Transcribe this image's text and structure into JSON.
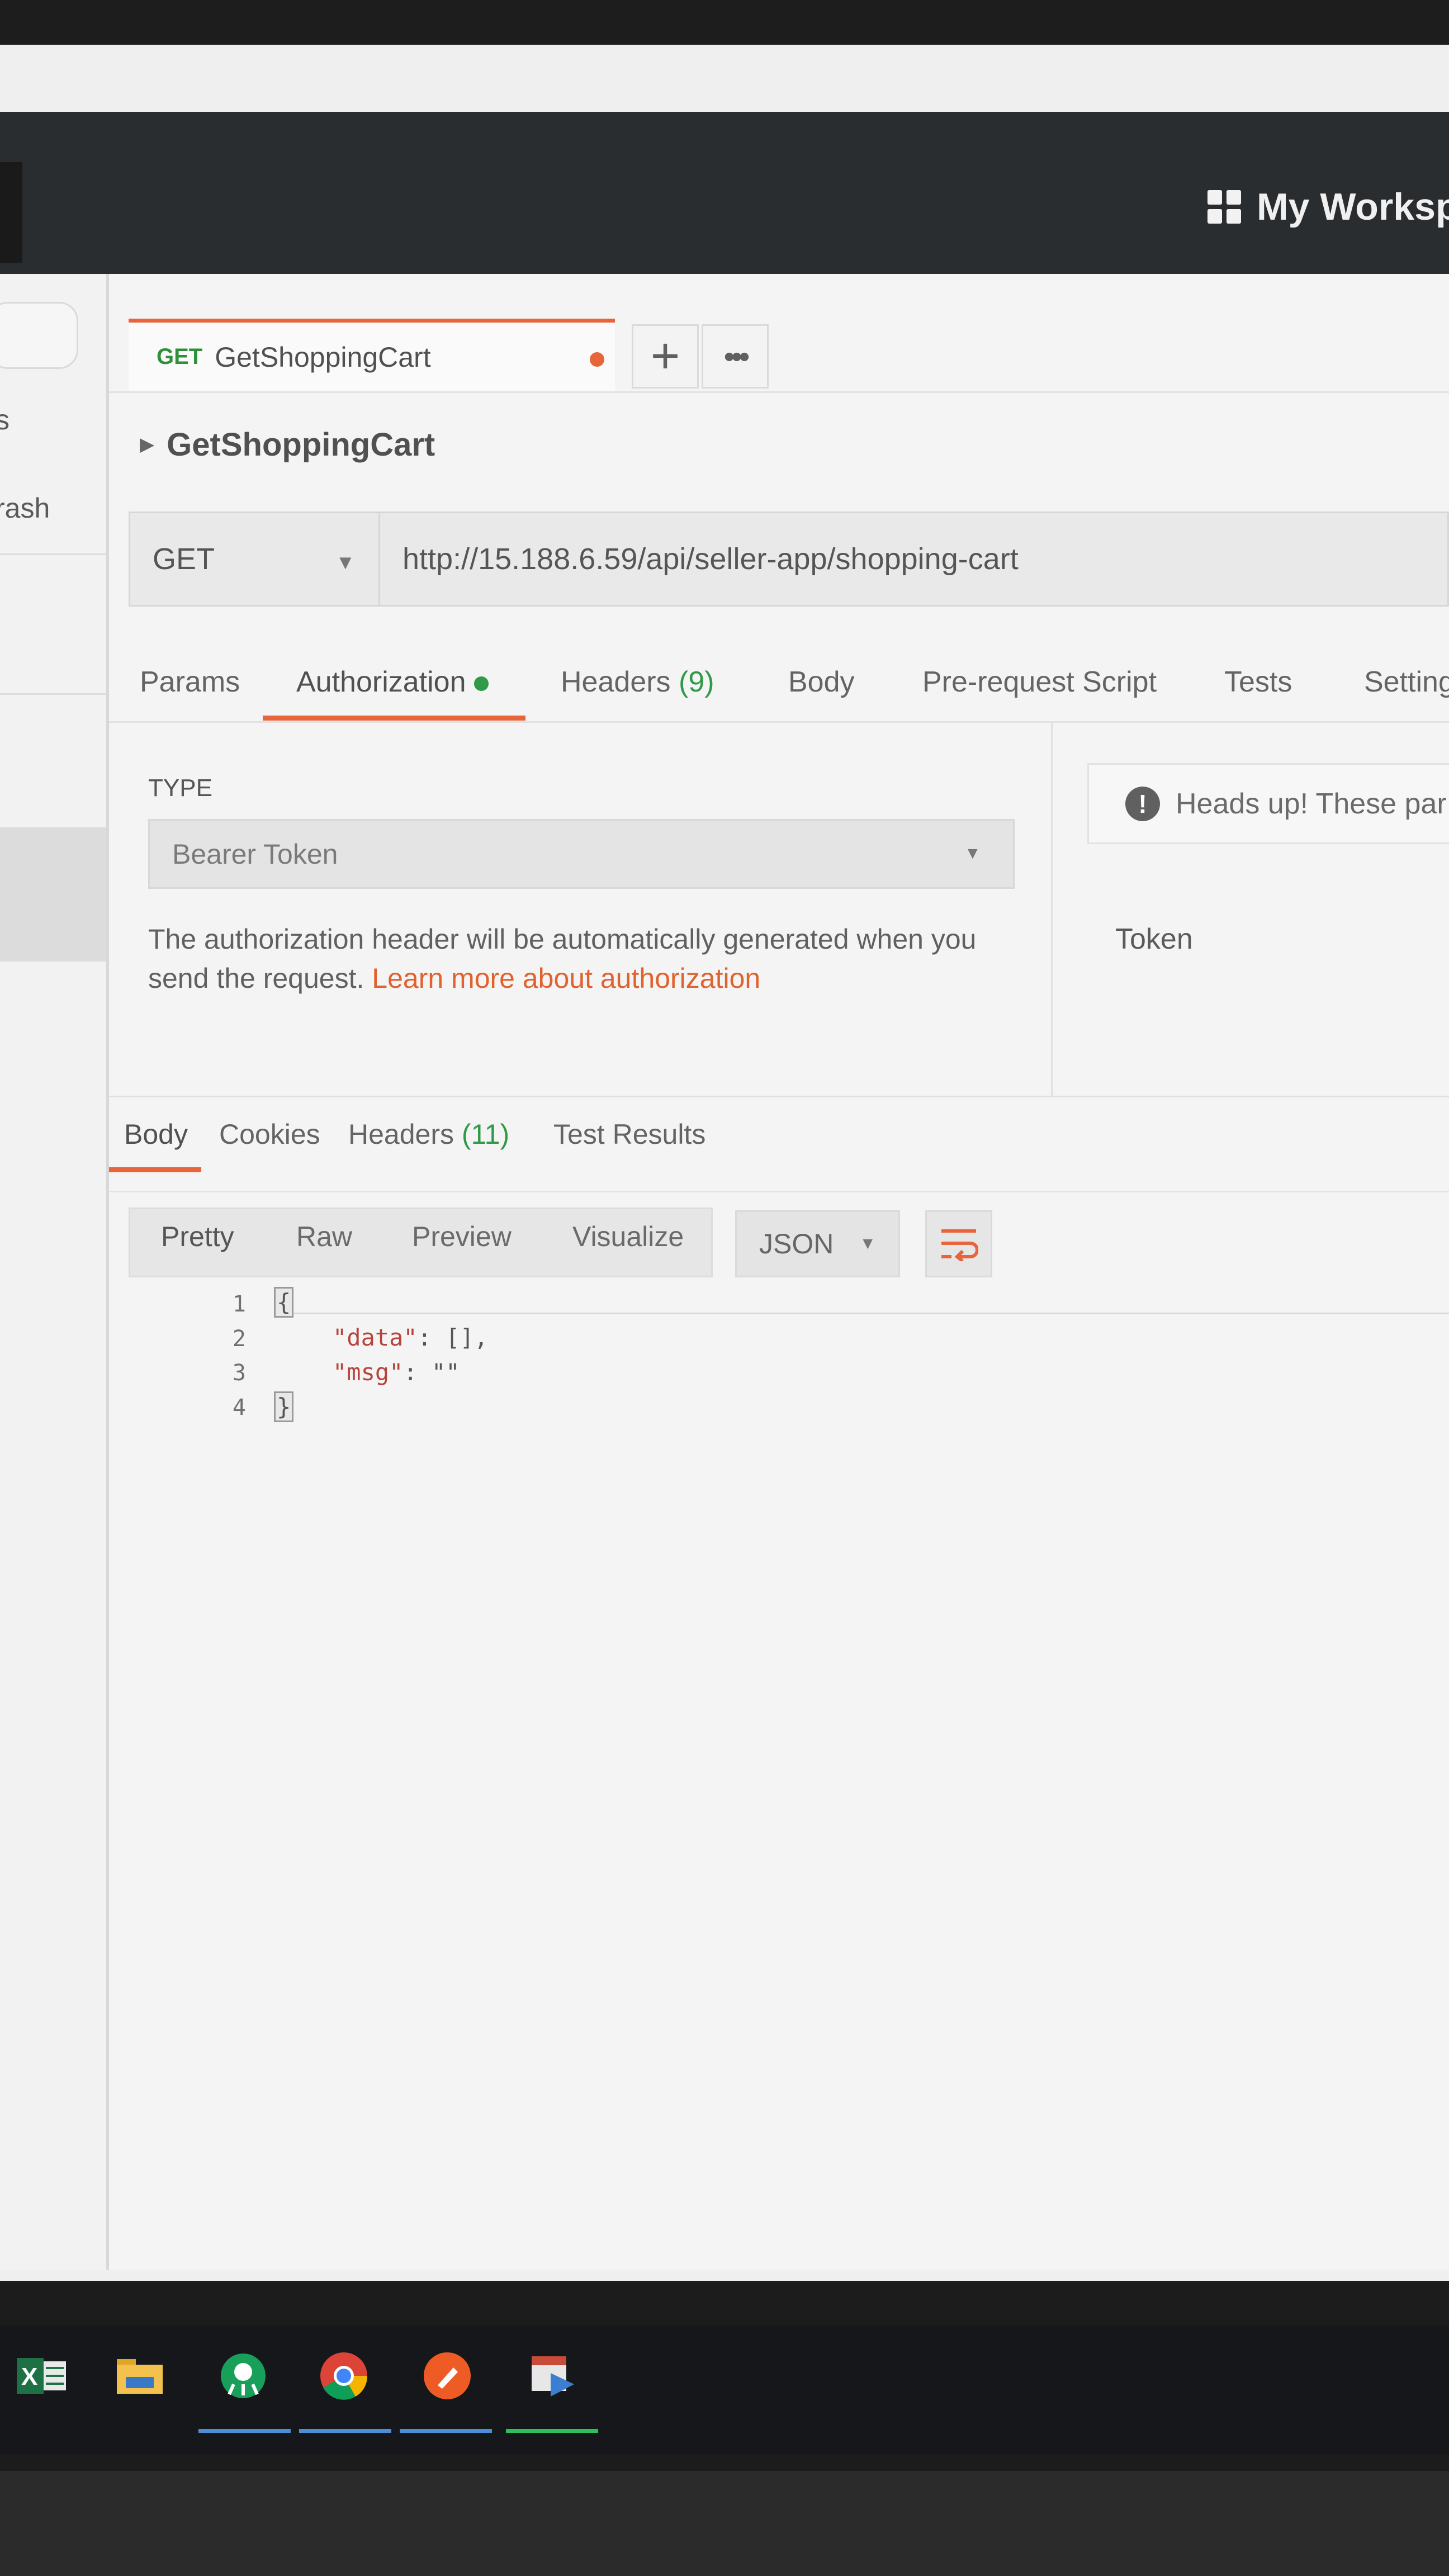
{
  "header": {
    "workspace_label": "My Worksp"
  },
  "sidebar": {
    "partial_item_top": "s",
    "trash_label": "rash"
  },
  "request_tab": {
    "method": "GET",
    "name": "GetShoppingCart",
    "add_symbol": "+",
    "more_symbol": "•••"
  },
  "breadcrumb": {
    "title": "GetShoppingCart"
  },
  "request": {
    "method": "GET",
    "url": "http://15.188.6.59/api/seller-app/shopping-cart"
  },
  "request_tabs": [
    {
      "label": "Params"
    },
    {
      "label": "Authorization"
    },
    {
      "label": "Headers",
      "count": "(9)"
    },
    {
      "label": "Body"
    },
    {
      "label": "Pre-request Script"
    },
    {
      "label": "Tests"
    },
    {
      "label": "Setting"
    }
  ],
  "authorization": {
    "type_label": "TYPE",
    "type_value": "Bearer Token",
    "description": "The authorization header will be automatically generated when you send the request. ",
    "link_text": "Learn more about authorization",
    "heads_up": "Heads up! These par",
    "token_label": "Token"
  },
  "response_tabs": [
    {
      "label": "Body"
    },
    {
      "label": "Cookies"
    },
    {
      "label": "Headers",
      "count": "(11)"
    },
    {
      "label": "Test Results"
    }
  ],
  "format": {
    "options": [
      "Pretty",
      "Raw",
      "Preview",
      "Visualize"
    ],
    "selected": "Pretty",
    "language": "JSON"
  },
  "response_body": {
    "lines": [
      {
        "no": "1",
        "text": "{"
      },
      {
        "no": "2",
        "key": "\"data\"",
        "value": ": [],"
      },
      {
        "no": "3",
        "key": "\"msg\"",
        "value": ": \"\""
      },
      {
        "no": "4",
        "text": "}"
      }
    ]
  },
  "taskbar": {
    "apps": [
      "excel-icon",
      "file-explorer-icon",
      "gitkraken-icon",
      "chrome-icon",
      "postman-icon",
      "calendar-app-icon"
    ],
    "accent": "#4a8fd8"
  },
  "colors": {
    "accent": "#e8643a",
    "success": "#2f9a47",
    "header_bg": "#2a2d30"
  }
}
